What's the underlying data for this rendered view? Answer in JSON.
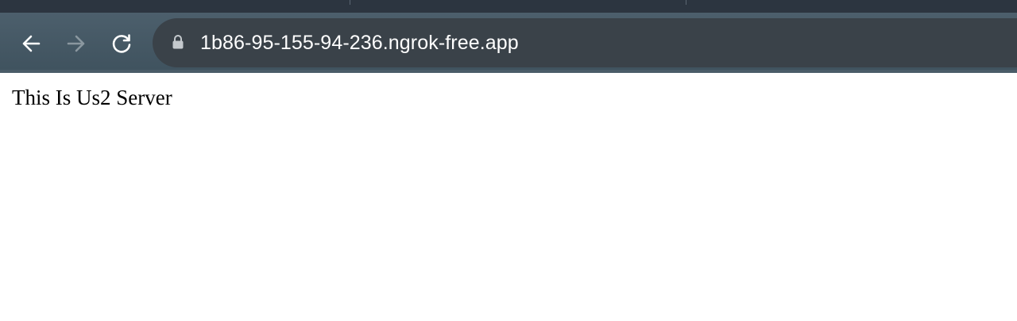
{
  "browser": {
    "address_bar": {
      "url": "1b86-95-155-94-236.ngrok-free.app"
    },
    "icons": {
      "back": "arrow-left-icon",
      "forward": "arrow-right-icon",
      "reload": "reload-icon",
      "lock": "lock-icon"
    },
    "colors": {
      "toolbar": "#45575F",
      "omnibox": "#3A4249",
      "tabstrip": "#2C3540"
    }
  },
  "page": {
    "text": "This Is Us2 Server"
  }
}
